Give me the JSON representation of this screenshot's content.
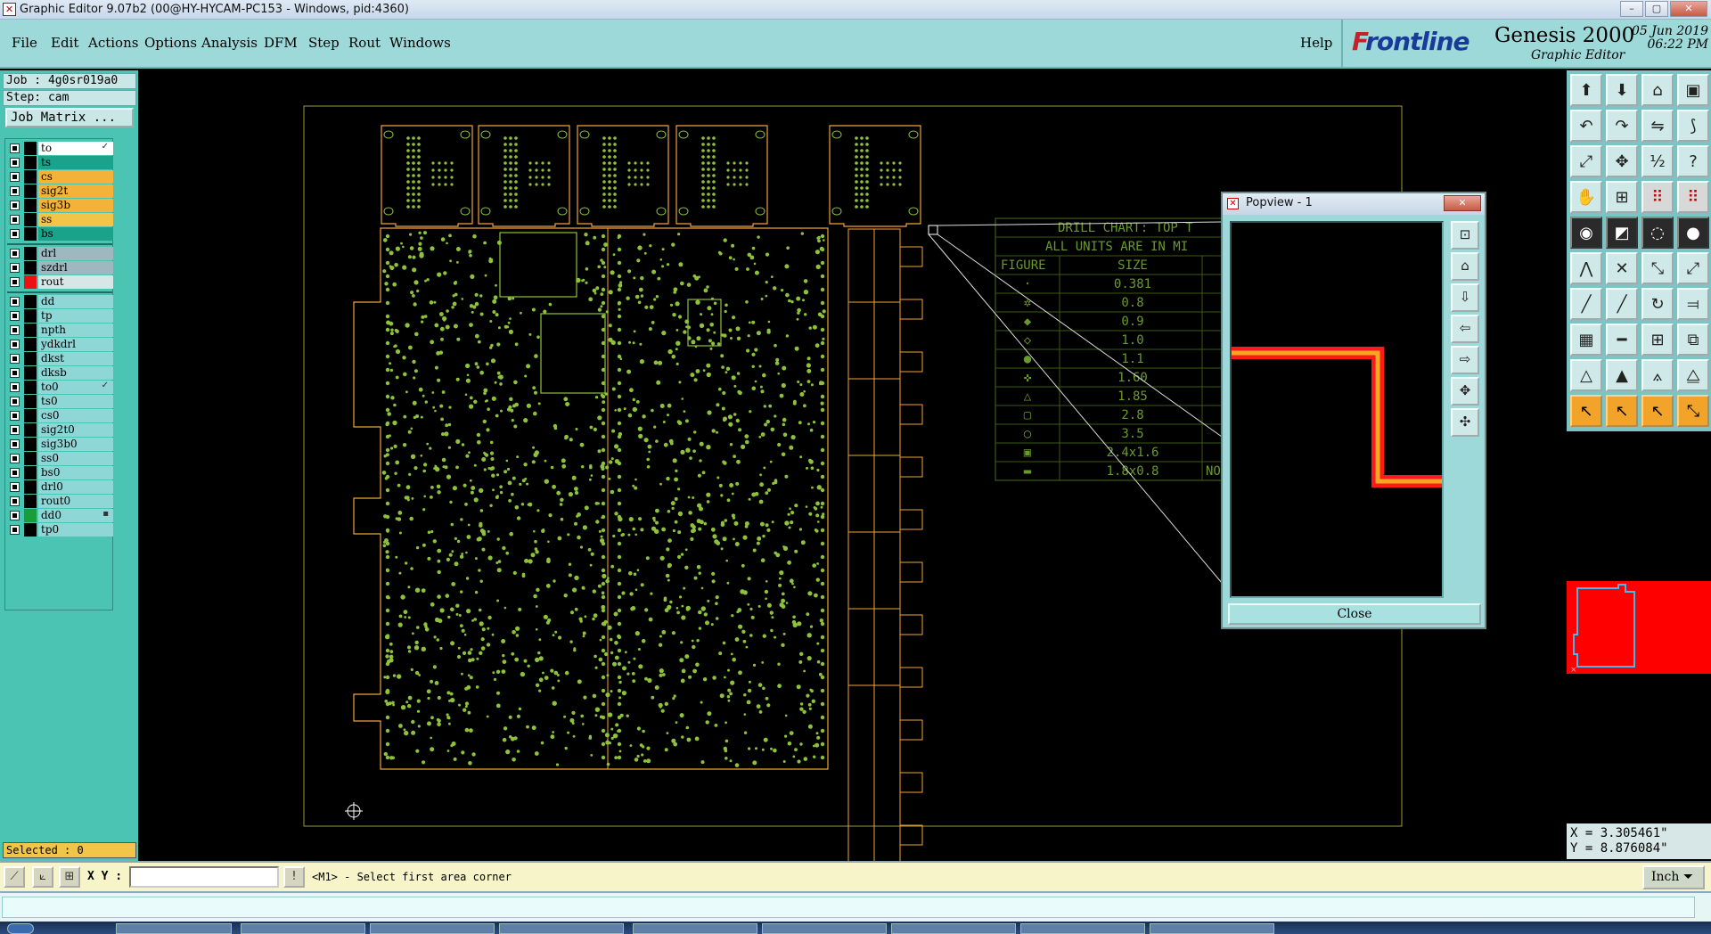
{
  "window": {
    "title": "Graphic Editor 9.07b2 (00@HY-HYCAM-PC153 - Windows, pid:4360)",
    "controls": [
      "–",
      "▢",
      "✕"
    ]
  },
  "menu": {
    "items": [
      "File",
      "Edit",
      "Actions",
      "Options",
      "Analysis",
      "DFM",
      "Step",
      "Rout",
      "Windows"
    ],
    "help": "Help"
  },
  "brand": {
    "logo_f": "F",
    "logo_rest": "rontline",
    "product": "Genesis 2000",
    "subtitle": "Graphic Editor",
    "date": "05 Jun 2019",
    "time": "06:22 PM"
  },
  "job": {
    "job_line": "Job : 4g0sr019a0",
    "step_line": "Step: cam",
    "matrix_button": "Job Matrix ..."
  },
  "layers": [
    {
      "name": "to",
      "color": "#ffffff",
      "swatch": "#000000",
      "mark": "✓"
    },
    {
      "name": "ts",
      "color": "#1aa38a",
      "swatch": "#000000",
      "mark": ""
    },
    {
      "name": "cs",
      "color": "#f3b33a",
      "swatch": "#000000",
      "mark": ""
    },
    {
      "name": "sig2t",
      "color": "#f3b33a",
      "swatch": "#000000",
      "mark": ""
    },
    {
      "name": "sig3b",
      "color": "#f3b33a",
      "swatch": "#000000",
      "mark": ""
    },
    {
      "name": "ss",
      "color": "#f3c44a",
      "swatch": "#000000",
      "mark": ""
    },
    {
      "name": "bs",
      "color": "#1aa38a",
      "swatch": "#000000",
      "mark": ""
    },
    {
      "name": "drl",
      "color": "#9fb8c0",
      "swatch": "#000000",
      "mark": ""
    },
    {
      "name": "szdrl",
      "color": "#9fb8c0",
      "swatch": "#000000",
      "mark": ""
    },
    {
      "name": "rout",
      "color": "#d7e7e7",
      "swatch": "#ee1111",
      "mark": ""
    },
    {
      "name": "dd",
      "color": "#8fd6d6",
      "swatch": "#000000",
      "mark": ""
    },
    {
      "name": "tp",
      "color": "#8fd6d6",
      "swatch": "#000000",
      "mark": ""
    },
    {
      "name": "npth",
      "color": "#8fd6d6",
      "swatch": "#000000",
      "mark": ""
    },
    {
      "name": "ydkdrl",
      "color": "#8fd6d6",
      "swatch": "#000000",
      "mark": ""
    },
    {
      "name": "dkst",
      "color": "#8fd6d6",
      "swatch": "#000000",
      "mark": ""
    },
    {
      "name": "dksb",
      "color": "#8fd6d6",
      "swatch": "#000000",
      "mark": ""
    },
    {
      "name": "to0",
      "color": "#8fd6d6",
      "swatch": "#000000",
      "mark": "✓"
    },
    {
      "name": "ts0",
      "color": "#8fd6d6",
      "swatch": "#000000",
      "mark": ""
    },
    {
      "name": "cs0",
      "color": "#8fd6d6",
      "swatch": "#000000",
      "mark": ""
    },
    {
      "name": "sig2t0",
      "color": "#8fd6d6",
      "swatch": "#000000",
      "mark": ""
    },
    {
      "name": "sig3b0",
      "color": "#8fd6d6",
      "swatch": "#000000",
      "mark": ""
    },
    {
      "name": "ss0",
      "color": "#8fd6d6",
      "swatch": "#000000",
      "mark": ""
    },
    {
      "name": "bs0",
      "color": "#8fd6d6",
      "swatch": "#000000",
      "mark": ""
    },
    {
      "name": "drl0",
      "color": "#8fd6d6",
      "swatch": "#000000",
      "mark": ""
    },
    {
      "name": "rout0",
      "color": "#8fd6d6",
      "swatch": "#000000",
      "mark": ""
    },
    {
      "name": "dd0",
      "color": "#8fd6d6",
      "swatch": "#1a9c3a",
      "mark": "▪"
    },
    {
      "name": "tp0",
      "color": "#8fd6d6",
      "swatch": "#000000",
      "mark": ""
    }
  ],
  "selected_label": "Selected : 0",
  "drill_chart": {
    "title": "DRILL CHART: TOP T",
    "units_note": "ALL UNITS ARE IN MI",
    "col_figure": "FIGURE",
    "col_size": "SIZE",
    "rows": [
      {
        "figure": "·",
        "size": "0.381"
      },
      {
        "figure": "✲",
        "size": "0.8"
      },
      {
        "figure": "◆",
        "size": "0.9"
      },
      {
        "figure": "◇",
        "size": "1.0"
      },
      {
        "figure": "●",
        "size": "1.1"
      },
      {
        "figure": "✜",
        "size": "1.60"
      },
      {
        "figure": "△",
        "size": "1.85"
      },
      {
        "figure": "▢",
        "size": "2.8"
      },
      {
        "figure": "○",
        "size": "3.5"
      },
      {
        "figure": "▣",
        "size": "2.4x1.6"
      },
      {
        "figure": "▬",
        "size": "1.8x0.8",
        "note": "NO"
      }
    ]
  },
  "popview": {
    "title": "Popview - 1",
    "close_x": "✕",
    "close_button": "Close"
  },
  "coords": {
    "x_line": "X = 3.305461\"",
    "y_line": "Y = 8.876084\""
  },
  "cmd": {
    "xy_label": "X Y :",
    "xy_value": "",
    "info_button": "!",
    "prompt": "<M1> - Select first area corner",
    "units": "Inch"
  },
  "colors": {
    "board_outline": "#f0a438",
    "pads": "#8dc23a",
    "trace_red": "#ff1a1a",
    "trace_yellow": "#f5a623",
    "minimap_bg": "#ff0000"
  }
}
